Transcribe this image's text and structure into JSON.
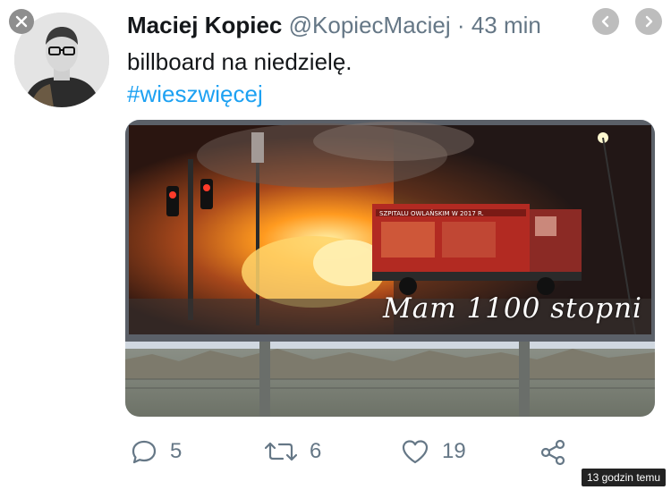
{
  "tweet": {
    "author_name": "Maciej Kopiec",
    "handle": "@KopiecMaciej",
    "separator": "·",
    "time": "43 min",
    "text": "billboard na niedzielę.",
    "hashtag": "#wieszwięcej"
  },
  "media": {
    "sign_text": "SZPITALU OWLAŃSKIM W 2017 R.",
    "caption": "Mam 1100 stopni"
  },
  "actions": {
    "replies": "5",
    "retweets": "6",
    "likes": "19"
  },
  "footer": {
    "timestamp": "13 godzin temu"
  },
  "colors": {
    "accent": "#1da1f2",
    "muted": "#657786"
  }
}
